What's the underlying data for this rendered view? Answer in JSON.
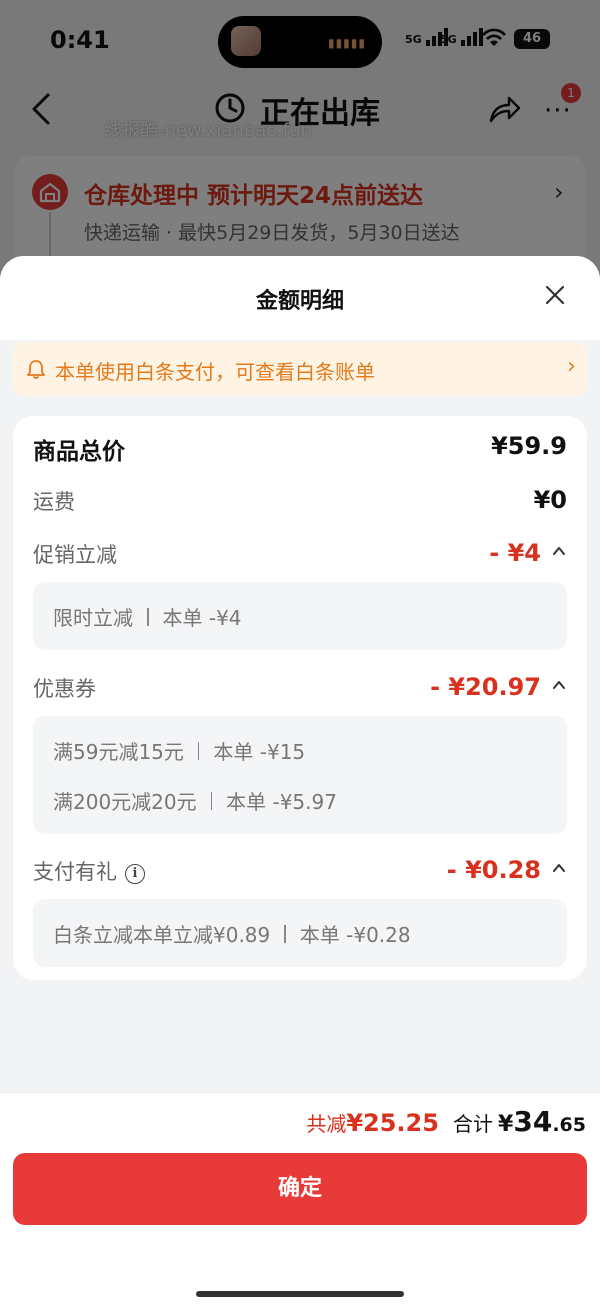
{
  "status_bar": {
    "time": "0:41",
    "network_1": "5G",
    "network_2": "5G",
    "battery": "46"
  },
  "nav": {
    "title": "正在出库",
    "watermark": "线报酷-new.xianbao.fun",
    "more_badge": "1"
  },
  "warehouse": {
    "title": "仓库处理中 预计明天24点前送达",
    "subtitle": "快递运输 · 最快5月29日发货，5月30日送达"
  },
  "sheet": {
    "title": "金额明细",
    "notice": "本单使用白条支付，可查看白条账单",
    "goods_total": {
      "label": "商品总价",
      "value": "¥59.9"
    },
    "shipping": {
      "label": "运费",
      "value": "¥0"
    },
    "promotion": {
      "label": "促销立减",
      "value": "- ¥4",
      "details": [
        {
          "name": "限时立减",
          "amount": "本单 -¥4"
        }
      ]
    },
    "coupon": {
      "label": "优惠券",
      "value": "- ¥20.97",
      "details": [
        {
          "name": "满59元减15元",
          "amount": "本单 -¥15"
        },
        {
          "name": "满200元减20元",
          "amount": "本单 -¥5.97"
        }
      ]
    },
    "payment_gift": {
      "label": "支付有礼",
      "value": "- ¥0.28",
      "details": [
        {
          "name": "白条立减本单立减¥0.89",
          "amount": "本单 -¥0.28"
        }
      ]
    }
  },
  "footer": {
    "save_label": "共减",
    "save_amount": "¥25.25",
    "total_label": "合计",
    "total_currency": "¥",
    "total_int": "34",
    "total_dec": ".65",
    "confirm_label": "确定"
  },
  "colors": {
    "accent_red": "#e93a3a",
    "discount_red": "#d8321f",
    "notice_orange": "#e47a1c",
    "notice_bg": "#fff4e3"
  }
}
